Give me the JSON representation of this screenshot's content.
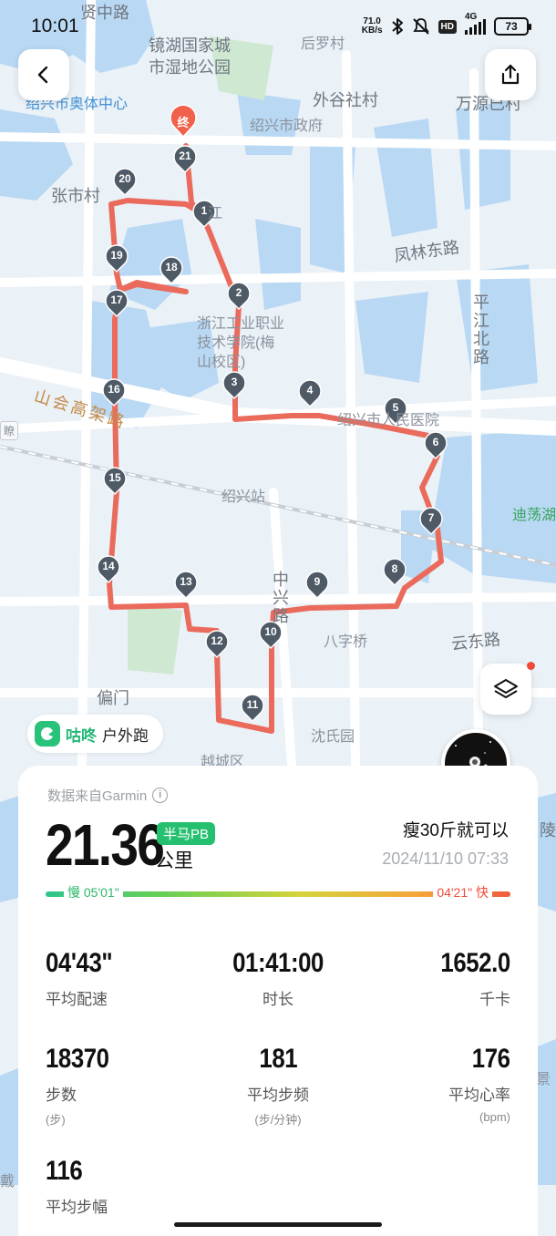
{
  "status_bar": {
    "time": "10:01",
    "net_speed_value": "71.0",
    "net_speed_unit": "KB/s",
    "network": "4G",
    "hd": "HD",
    "battery": "73"
  },
  "map": {
    "place_labels": {
      "jinghu_park": "镜湖国家城\n市湿地公园",
      "aoti_center": "绍兴市奥体中心",
      "zhongxin_lu": "贤中路",
      "houluo_cun": "后罗村",
      "waigu_she_cun": "外谷社村",
      "wanyuan": "万源已村",
      "gov": "绍兴市政府",
      "zhangshi_cun": "张市村",
      "jiang": "江",
      "fenglin_road": "凤林东路",
      "pingjiang_road": "平江北路",
      "college": "浙江工业职业\n技术学院(梅\n山校区)",
      "shanhui_expressway": "山会高架路",
      "hospital": "绍兴市人民医院",
      "station": "绍兴站",
      "dixiang_lake": "迪荡湖",
      "zhongxing": "中兴路",
      "bazi_qiao": "八字桥",
      "yundong_road": "云东路",
      "pianmen": "偏门",
      "shenshi_yuan": "沈氏园",
      "yuecheng": "越城区",
      "ling": "陵",
      "jing": "景",
      "dai": "戴",
      "liao": "瞭"
    },
    "end_marker": "终",
    "markers": [
      "1",
      "2",
      "3",
      "4",
      "5",
      "6",
      "7",
      "8",
      "9",
      "10",
      "11",
      "12",
      "13",
      "14",
      "15",
      "16",
      "17",
      "18",
      "19",
      "20",
      "21"
    ],
    "route_color": "#ea6a5b",
    "marker_color": "#4e5a66"
  },
  "app": {
    "brand": "咕咚",
    "activity_type": "户外跑"
  },
  "summary": {
    "source": "数据来自Garmin",
    "distance": "21.36",
    "distance_unit": "公里",
    "pb_badge": "半马PB",
    "user_name": "瘦30斤就可以",
    "date": "2024/11/10 07:33",
    "pace_slow_label": "慢 05'01\"",
    "pace_fast_label": "04'21\" 快"
  },
  "stats": {
    "avg_pace": {
      "value": "04'43\"",
      "label": "平均配速"
    },
    "duration": {
      "value": "01:41:00",
      "label": "时长"
    },
    "calories": {
      "value": "1652.0",
      "label": "千卡"
    },
    "steps": {
      "value": "18370",
      "label": "步数",
      "unit": "(步)"
    },
    "cadence": {
      "value": "181",
      "label": "平均步频",
      "unit": "(步/分钟)"
    },
    "heart_rate": {
      "value": "176",
      "label": "平均心率",
      "unit": "(bpm)"
    },
    "stride": {
      "value": "116",
      "label": "平均步幅"
    }
  }
}
